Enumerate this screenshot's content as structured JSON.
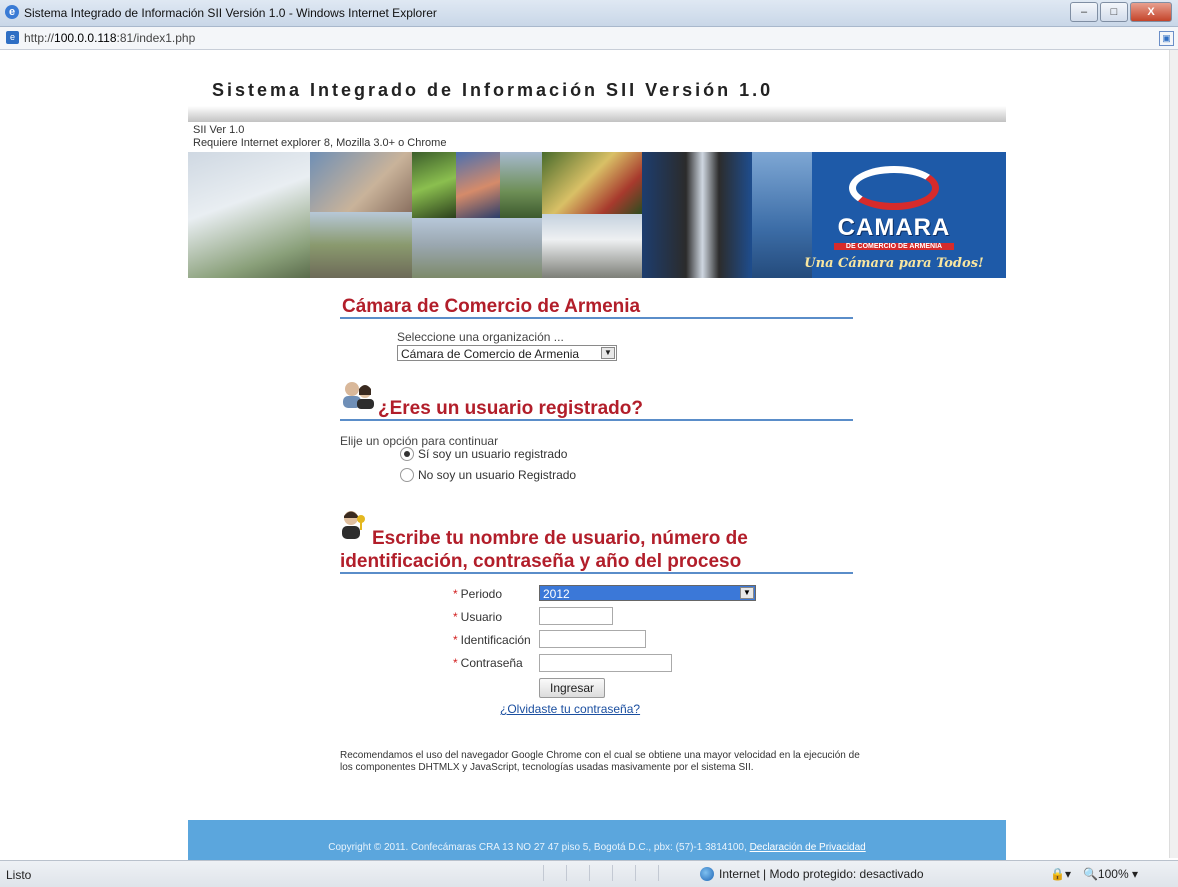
{
  "window": {
    "title": "Sistema Integrado de Información SII Versión 1.0 - Windows Internet Explorer",
    "minimize": "–",
    "maximize": "□",
    "close": "X"
  },
  "address_bar": {
    "url_prefix": "http://",
    "url_host": "100.0.0.118",
    "url_rest": ":81/index1.php"
  },
  "header": {
    "system_title": "Sistema Integrado de Información SII Versión 1.0",
    "version": "SII Ver 1.0",
    "requirements": "Requiere Internet explorer 8, Mozilla 3.0+ o Chrome"
  },
  "banner": {
    "logo_name": "CAMARA",
    "logo_sub": "DE COMERCIO DE ARMENIA",
    "logo_slogan": "Una Cámara para Todos!"
  },
  "org_section": {
    "title": "Cámara de Comercio de Armenia",
    "select_label": "Seleccione una organización ...",
    "selected_value": "Cámara de Comercio de Armenia"
  },
  "user_section": {
    "title": "¿Eres un usuario registrado?",
    "prompt": "Elije un opción para continuar",
    "options": [
      "Sí soy un usuario registrado",
      "No soy un usuario Registrado"
    ],
    "selected_index": 0
  },
  "login_section": {
    "title_line1": "Escribe tu nombre de usuario, número de",
    "title_line2": "identificación, contraseña y año del proceso",
    "required_mark": "*",
    "period_label": "Periodo",
    "period_value": "2012",
    "user_label": "Usuario",
    "id_label": "Identificación",
    "password_label": "Contraseña",
    "submit_label": "Ingresar",
    "forgot_link": "¿Olvidaste tu contraseña?"
  },
  "recommendation": "Recomendamos el uso del navegador Google Chrome con el cual se obtiene una mayor velocidad en la ejecución de los componentes DHTMLX y JavaScript, tecnologías usadas masivamente por el sistema SII.",
  "footer": {
    "copyright": "Copyright © 2011. Confecámaras CRA 13 NO 27 47 piso 5, Bogotá D.C., pbx: (57)-1 3814100,",
    "privacy_link": "Declaración de Privacidad"
  },
  "statusbar": {
    "status": "Listo",
    "zone": "Internet | Modo protegido: desactivado",
    "zoom": "100%"
  },
  "colors": {
    "accent_red": "#b21e2a",
    "section_line": "#5a8dc9",
    "footer_blue": "#5ba6dd",
    "banner_blue": "#1e5aa8"
  }
}
